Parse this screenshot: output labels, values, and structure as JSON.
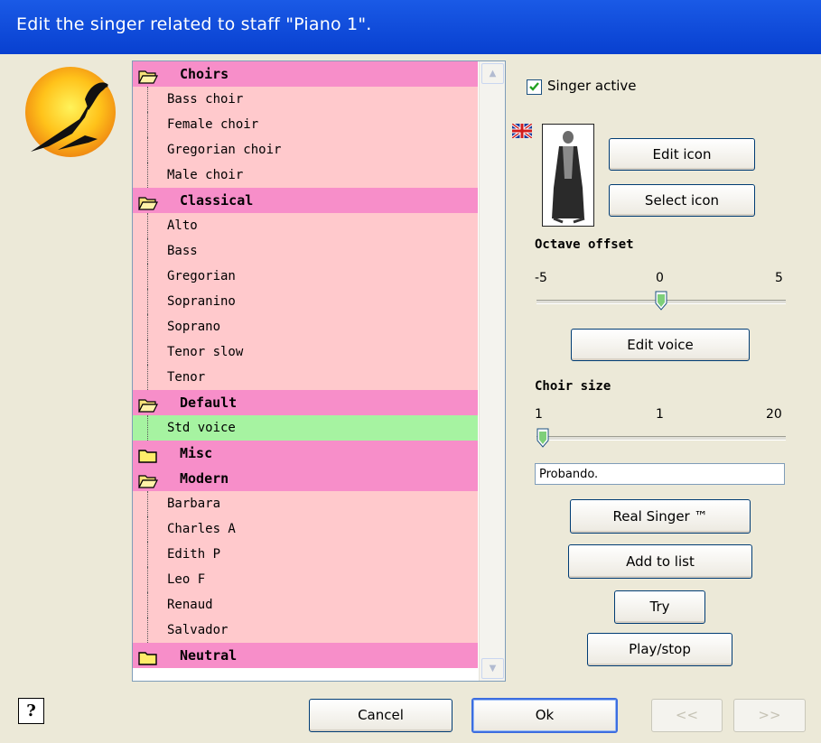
{
  "window": {
    "title": "Edit the singer related to staff \"Piano 1\"."
  },
  "list": {
    "rows": [
      {
        "type": "group",
        "label": "Choirs",
        "open": true
      },
      {
        "type": "item",
        "label": "Bass choir"
      },
      {
        "type": "item",
        "label": "Female choir"
      },
      {
        "type": "item",
        "label": "Gregorian choir"
      },
      {
        "type": "item",
        "label": "Male choir"
      },
      {
        "type": "group",
        "label": "Classical",
        "open": true
      },
      {
        "type": "item",
        "label": "Alto"
      },
      {
        "type": "item",
        "label": "Bass"
      },
      {
        "type": "item",
        "label": "Gregorian"
      },
      {
        "type": "item",
        "label": "Sopranino"
      },
      {
        "type": "item",
        "label": "Soprano"
      },
      {
        "type": "item",
        "label": "Tenor slow"
      },
      {
        "type": "item",
        "label": "Tenor"
      },
      {
        "type": "group",
        "label": "Default",
        "open": true
      },
      {
        "type": "item",
        "label": "Std voice",
        "selected": true
      },
      {
        "type": "group",
        "label": "Misc",
        "open": false
      },
      {
        "type": "group",
        "label": "Modern",
        "open": true
      },
      {
        "type": "item",
        "label": "Barbara"
      },
      {
        "type": "item",
        "label": "Charles A"
      },
      {
        "type": "item",
        "label": "Edith P"
      },
      {
        "type": "item",
        "label": "Leo F"
      },
      {
        "type": "item",
        "label": "Renaud"
      },
      {
        "type": "item",
        "label": "Salvador"
      },
      {
        "type": "group",
        "label": "Neutral",
        "open": false
      }
    ]
  },
  "singer_active": {
    "label": "Singer active",
    "checked": true
  },
  "buttons": {
    "edit_icon": "Edit icon",
    "select_icon": "Select icon",
    "edit_voice": "Edit voice",
    "real_singer": "Real Singer ™",
    "add_to_list": "Add to list",
    "try": "Try",
    "play_stop": "Play/stop",
    "cancel": "Cancel",
    "ok": "Ok",
    "prev": "<<",
    "next": ">>",
    "help": "?"
  },
  "octave": {
    "title": "Octave offset",
    "min_label": "-5",
    "mid_label": "0",
    "max_label": "5",
    "value": 0,
    "min": -5,
    "max": 5
  },
  "choir": {
    "title": "Choir size",
    "min_label": "1",
    "mid_label": "1",
    "max_label": "20",
    "value": 1,
    "min": 1,
    "max": 20
  },
  "text_field": {
    "value": "Probando."
  },
  "colors": {
    "group_bg": "#f78ec9",
    "item_bg": "#ffc9cc",
    "selected_bg": "#a6f3a1",
    "title_bar": "#0a46d8"
  },
  "icons": {
    "logo": "bird-logo-icon",
    "flag": "uk-flag-icon",
    "folder_open": "folder-open-icon",
    "folder_closed": "folder-closed-icon"
  }
}
